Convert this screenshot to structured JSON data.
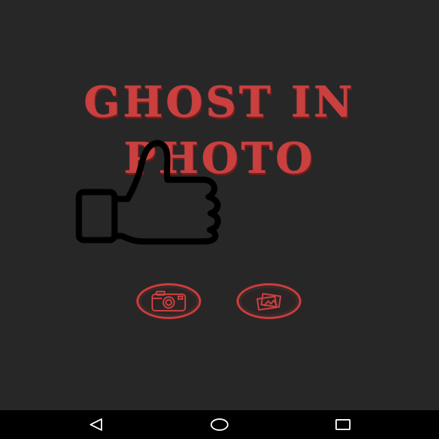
{
  "app": {
    "title_line_1": "GHOST IN",
    "title_line_2": "PHOTO",
    "accent_color": "#c9403f",
    "background_color": "#272727"
  },
  "overlay": {
    "icon": "thumbs-up-icon"
  },
  "actions": [
    {
      "name": "camera-button",
      "icon": "camera-icon"
    },
    {
      "name": "gallery-button",
      "icon": "gallery-icon"
    }
  ],
  "nav_bar": {
    "back_icon": "back-triangle-icon",
    "home_icon": "home-circle-icon",
    "recents_icon": "recents-square-icon"
  }
}
